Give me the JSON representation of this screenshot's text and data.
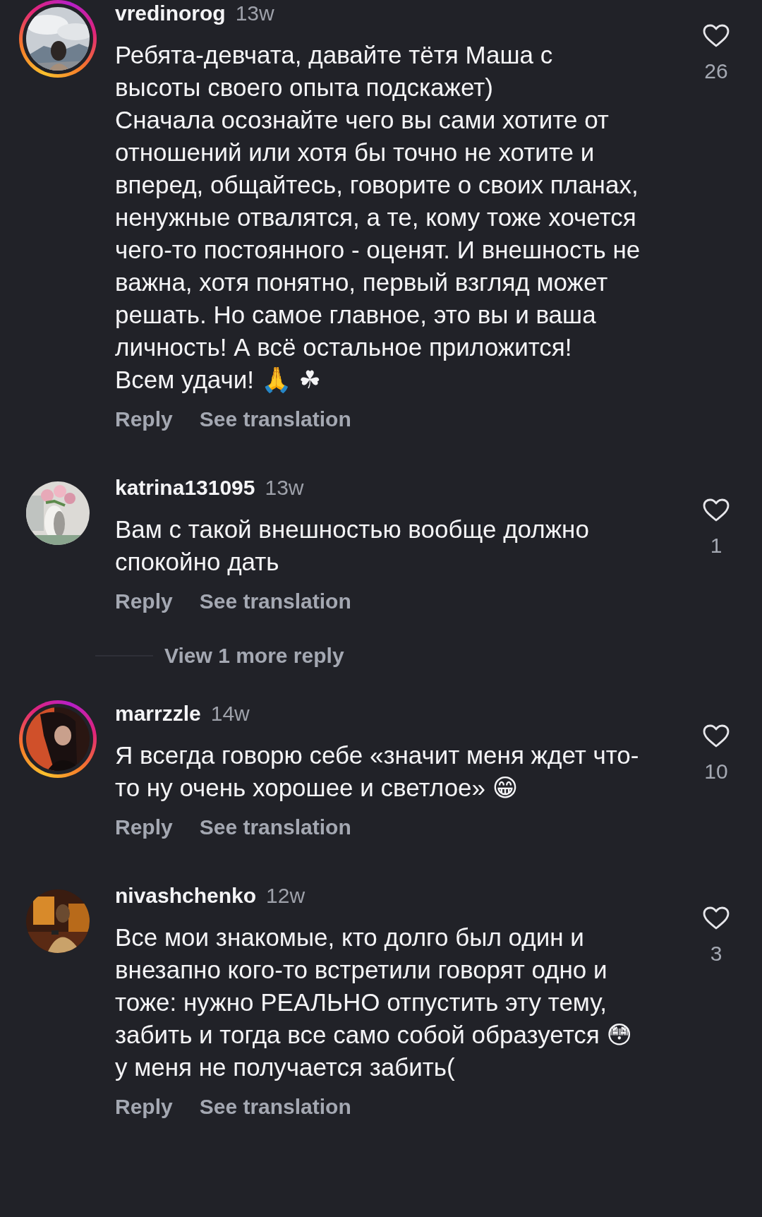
{
  "comments": [
    {
      "username": "vredinorog",
      "time": "13w",
      "story_ring": true,
      "paragraphs": [
        "Ребята-девчата, давайте тётя Маша с высоты своего опыта подскажет)",
        "Сначала осознайте чего вы сами хотите от отношений или хотя бы точно не хотите и вперед, общайтесь, говорите о своих планах, ненужные отвалятся, а те, кому тоже хочется чего-то постоянного - оценят. И внешность не важна, хотя понятно, первый взгляд может решать. Но самое главное, это вы и ваша личность! А всё остальное приложится!",
        "Всем удачи! 🙏 ☘"
      ],
      "likes": "26",
      "actions": [
        "Reply",
        "See translation"
      ]
    },
    {
      "username": "katrina131095",
      "time": "13w",
      "story_ring": false,
      "paragraphs": [
        "Вам с такой внешностью вообще должно спокойно дать"
      ],
      "likes": "1",
      "actions": [
        "Reply",
        "See translation"
      ],
      "more_replies": "View 1 more reply"
    },
    {
      "username": "marrzzle",
      "time": "14w",
      "story_ring": true,
      "paragraphs": [
        "Я всегда говорю себе «значит меня ждет что-то ну очень хорошее и светлое» 😁"
      ],
      "likes": "10",
      "actions": [
        "Reply",
        "See translation"
      ]
    },
    {
      "username": "nivashchenko",
      "time": "12w",
      "story_ring": false,
      "paragraphs": [
        "Все мои знакомые, кто долго был один и внезапно кого-то встретили говорят одно и тоже: нужно РЕАЛЬНО отпустить эту тему, забить и тогда все само собой образуется 😳",
        "у меня не получается забить("
      ],
      "likes": "3",
      "actions": [
        "Reply",
        "See translation"
      ]
    }
  ]
}
